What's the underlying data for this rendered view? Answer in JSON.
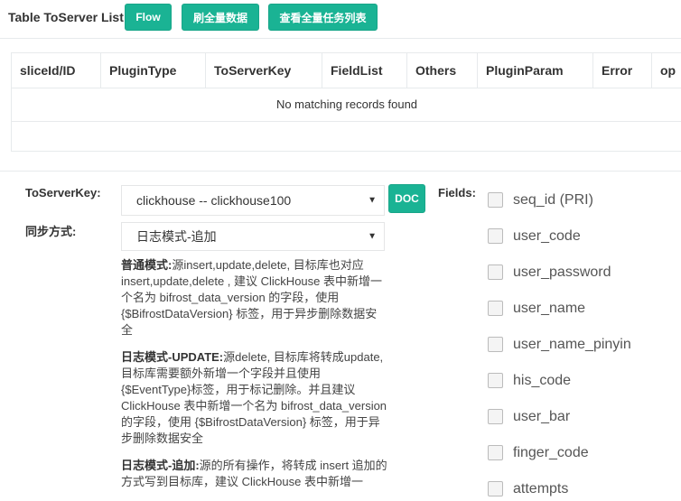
{
  "header": {
    "title": "Table ToServer List",
    "buttons": {
      "flow": "Flow",
      "refresh_full": "刷全量数据",
      "view_full_tasks": "查看全量任务列表"
    }
  },
  "table": {
    "columns": [
      "sliceId/ID",
      "PluginType",
      "ToServerKey",
      "FieldList",
      "Others",
      "PluginParam",
      "Error",
      "op"
    ],
    "empty_message": "No matching records found"
  },
  "form": {
    "toserverkey_label": "ToServerKey:",
    "toserverkey_value": "clickhouse -- clickhouse100",
    "doc_button": "DOC",
    "sync_label": "同步方式:",
    "sync_value": "日志模式-追加",
    "help": [
      {
        "title": "普通模式:",
        "text": "源insert,update,delete, 目标库也对应insert,update,delete , 建议 ClickHouse 表中新增一个名为 bifrost_data_version 的字段，使用 {$BifrostDataVersion} 标签，用于异步删除数据安全"
      },
      {
        "title": "日志模式-UPDATE:",
        "text": "源delete, 目标库将转成update, 目标库需要额外新增一个字段并且使用 {$EventType}标签，用于标记删除。并且建议 ClickHouse 表中新增一个名为 bifrost_data_version 的字段，使用 {$BifrostDataVersion} 标签，用于异步删除数据安全"
      },
      {
        "title": "日志模式-追加:",
        "text": "源的所有操作，将转成 insert 追加的方式写到目标库，建议 ClickHouse 表中新增一"
      }
    ]
  },
  "fields": {
    "label": "Fields:",
    "items": [
      "seq_id (PRI)",
      "user_code",
      "user_password",
      "user_name",
      "user_name_pinyin",
      "his_code",
      "user_bar",
      "finger_code",
      "attempts"
    ]
  }
}
